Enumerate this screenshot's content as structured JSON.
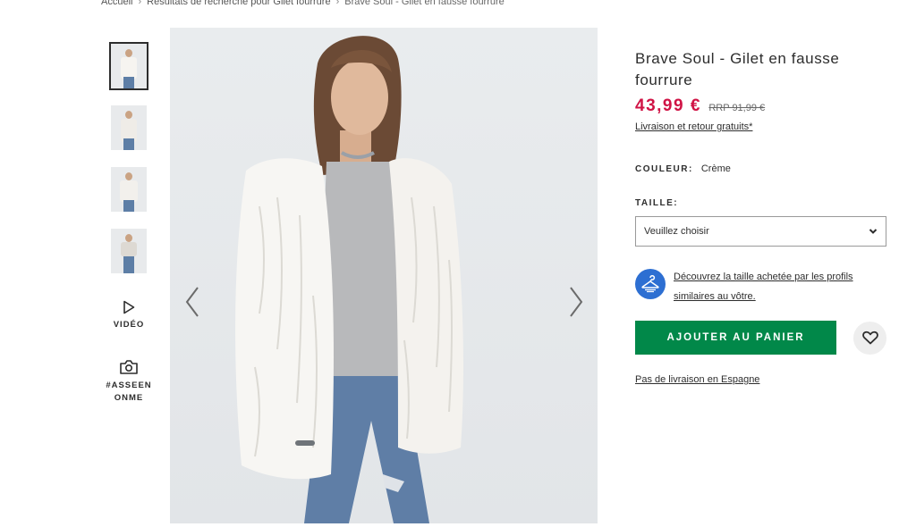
{
  "breadcrumb": {
    "items": [
      "Accueil",
      "Résultats de recherche pour Gilet fourrure",
      "Brave Soul - Gilet en fausse fourrure"
    ],
    "separator": "›"
  },
  "gallery": {
    "video_label": "VIDÉO",
    "asseen_label_line1": "#ASSEEN",
    "asseen_label_line2": "ONME"
  },
  "product": {
    "title": "Brave Soul - Gilet en fausse fourrure",
    "price": "43,99 €",
    "rrp": "RRP 91,99 €",
    "shipping_link": "Livraison et retour gratuits*",
    "color_label": "COULEUR:",
    "color_value": "Crème",
    "size_label": "TAILLE:",
    "size_placeholder": "Veuillez choisir",
    "fit_link": "Découvrez la taille achetée par les profils similaires au vôtre.",
    "add_to_cart": "AJOUTER AU PANIER",
    "no_delivery": "Pas de livraison en Espagne"
  },
  "colors": {
    "price_red": "#d01345",
    "cart_green": "#018849",
    "fit_blue": "#2d6fd2"
  },
  "icons": [
    "play-icon",
    "camera-icon",
    "chevron-left-icon",
    "chevron-right-icon",
    "chevron-down-icon",
    "hanger-icon",
    "heart-icon"
  ]
}
